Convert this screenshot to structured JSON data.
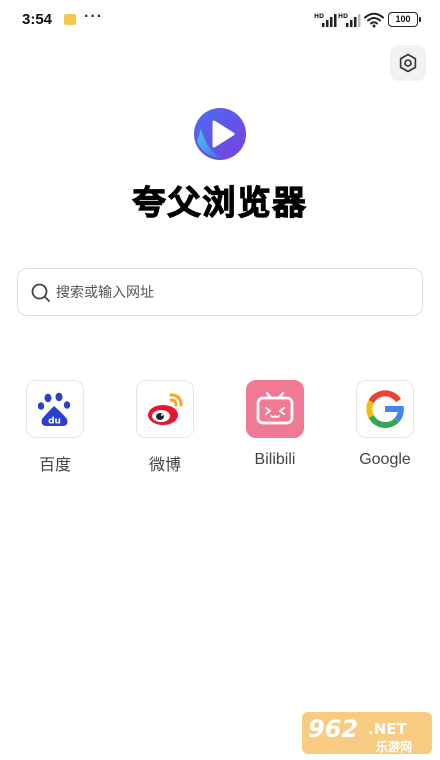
{
  "status_bar": {
    "time": "3:54",
    "more": "···",
    "battery": "100",
    "icons": [
      "notification-icon",
      "hd-signal-icon",
      "hd-signal-icon",
      "wifi-icon",
      "battery-icon"
    ]
  },
  "settings": {
    "icon": "settings-hexagon-icon"
  },
  "header": {
    "title": "夸父浏览器",
    "logo_icon": "play-button-logo"
  },
  "search": {
    "placeholder": "搜索或输入网址",
    "value": "",
    "icon": "search-icon"
  },
  "shortcuts": [
    {
      "label": "百度",
      "icon": "baidu-paw-icon"
    },
    {
      "label": "微博",
      "icon": "weibo-eye-icon"
    },
    {
      "label": "Bilibili",
      "icon": "bilibili-tv-icon"
    },
    {
      "label": "Google",
      "icon": "google-g-icon"
    }
  ],
  "watermark": {
    "number": "962",
    "suffix": ".NET",
    "caption": "乐游网"
  },
  "colors": {
    "logo_blue": "#3b3fd9",
    "logo_purple": "#7a3fe0",
    "baidu_blue": "#2b3fcf",
    "weibo_red": "#e6162d",
    "weibo_orange": "#f5a623",
    "bilibili_pink": "#f07a93",
    "border_gray": "#dcdcdc"
  }
}
